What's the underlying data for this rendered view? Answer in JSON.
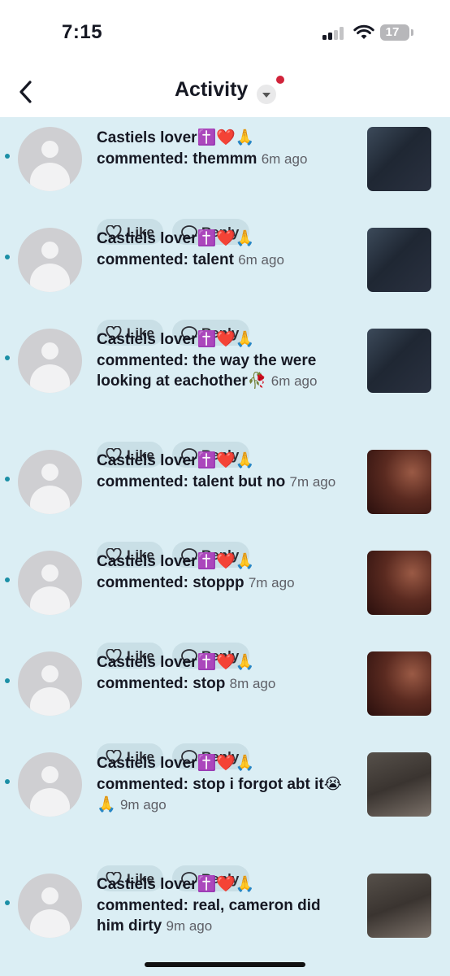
{
  "status_bar": {
    "time": "7:15",
    "battery": "17",
    "icons": [
      "cellular-signal-icon",
      "wifi-icon",
      "battery-icon"
    ]
  },
  "header": {
    "title": "Activity",
    "back_icon": "chevron-left-icon",
    "dropdown_icon": "caret-down-icon",
    "has_notification_dot": true
  },
  "colors": {
    "feed_background": "#dbeef4",
    "pill_background": "#c9dfe6",
    "unread_dot": "#1b8fa6",
    "notification_dot": "#d1233a"
  },
  "actions": {
    "like": "Like",
    "reply": "Reply"
  },
  "items": [
    {
      "user": "Castiels lover",
      "user_emoji": "✝️❤️🙏",
      "comment": "commented: themmm",
      "comment_emoji": "",
      "time": "6m ago",
      "thumbnail": "suit-man-with-white-cat",
      "unread": true
    },
    {
      "user": "Castiels lover",
      "user_emoji": "✝️❤️🙏",
      "comment": "commented: talent",
      "comment_emoji": "",
      "time": "6m ago",
      "thumbnail": "suit-man-with-white-cat",
      "unread": true
    },
    {
      "user": "Castiels lover",
      "user_emoji": "✝️❤️🙏",
      "comment": "commented: the way the were looking at eachother",
      "comment_emoji": "🥀",
      "time": "6m ago",
      "thumbnail": "suit-man-with-white-cat",
      "unread": true
    },
    {
      "user": "Castiels lover",
      "user_emoji": "✝️❤️🙏",
      "comment": "commented: talent but no",
      "comment_emoji": "",
      "time": "7m ago",
      "thumbnail": "man-looking-up-red-background",
      "unread": true
    },
    {
      "user": "Castiels lover",
      "user_emoji": "✝️❤️🙏",
      "comment": "commented: stoppp",
      "comment_emoji": "",
      "time": "7m ago",
      "thumbnail": "man-looking-up-red-background",
      "unread": true
    },
    {
      "user": "Castiels lover",
      "user_emoji": "✝️❤️🙏",
      "comment": "commented: stop",
      "comment_emoji": "",
      "time": "8m ago",
      "thumbnail": "man-looking-up-red-background",
      "unread": true
    },
    {
      "user": "Castiels lover",
      "user_emoji": "✝️❤️🙏",
      "comment": "commented: stop i forgot abt it",
      "comment_emoji": "😭🙏",
      "time": "9m ago",
      "thumbnail": "man-in-white-coat-and-tie",
      "unread": true
    },
    {
      "user": "Castiels lover",
      "user_emoji": "✝️❤️🙏",
      "comment": "commented: real, cameron did him dirty",
      "comment_emoji": "",
      "time": "9m ago",
      "thumbnail": "man-in-white-coat-and-tie",
      "unread": true
    }
  ]
}
